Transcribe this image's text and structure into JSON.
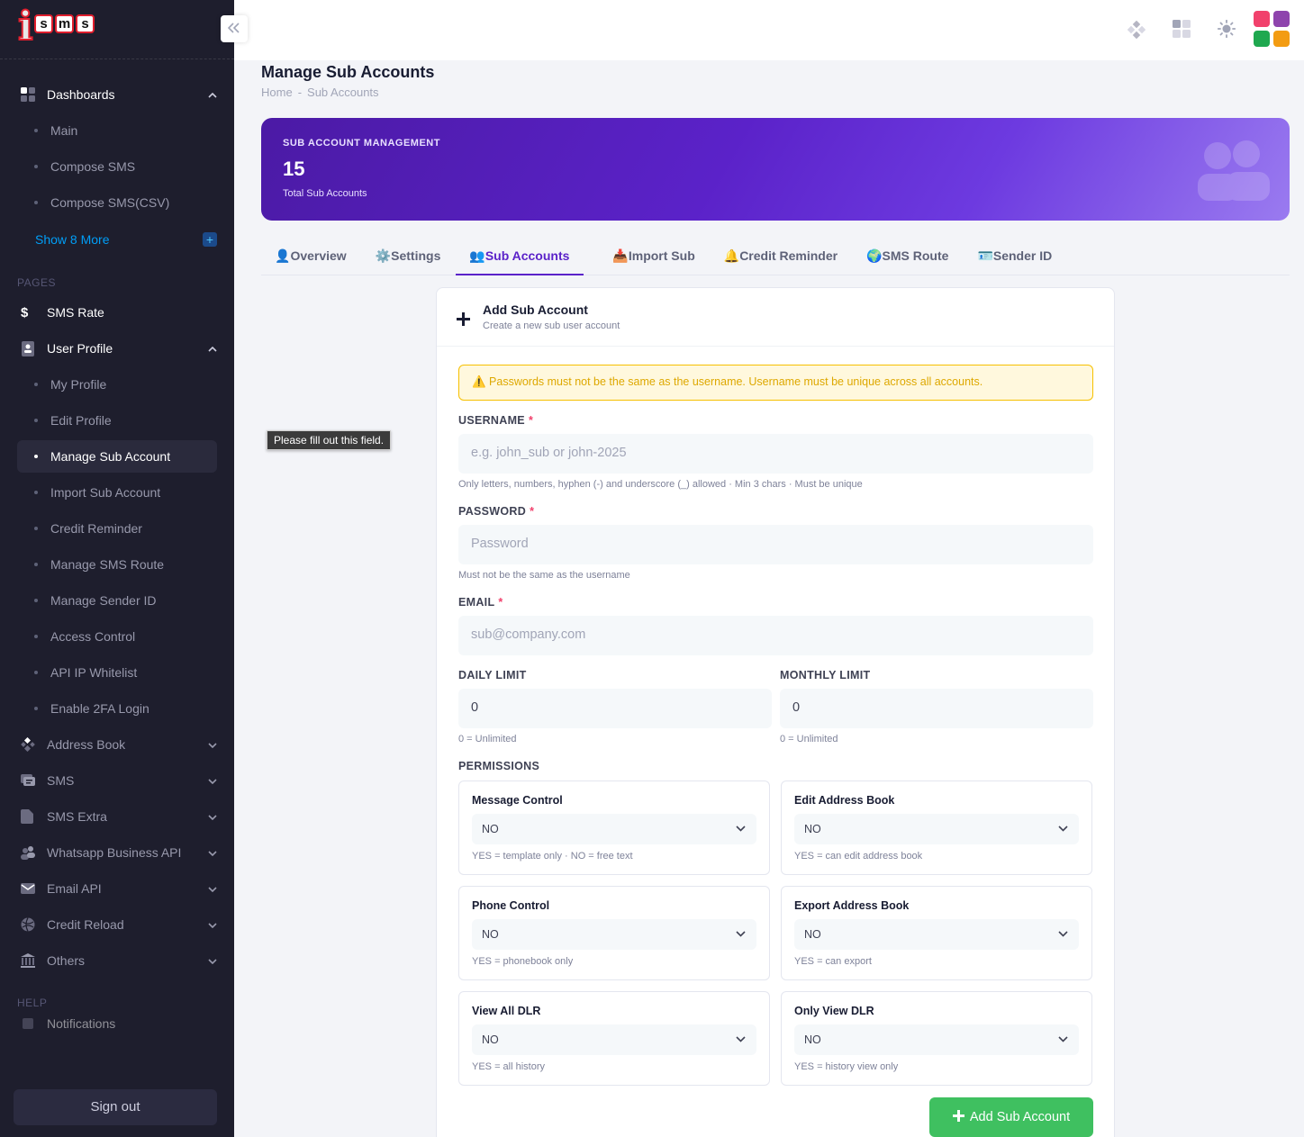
{
  "brand": {
    "logo_letter": "i",
    "logo_boxes": [
      "s",
      "m",
      "s"
    ]
  },
  "sidebar": {
    "collapse_icon": "double-chevron-left-icon",
    "dashboards": {
      "label": "Dashboards",
      "items": [
        "Main",
        "Compose SMS",
        "Compose SMS(CSV)"
      ],
      "show_more": "Show 8 More"
    },
    "pages_label": "PAGES",
    "sms_rate": "SMS Rate",
    "user_profile": {
      "label": "User Profile",
      "items": [
        "My Profile",
        "Edit Profile",
        "Manage Sub Account",
        "Import Sub Account",
        "Credit Reminder",
        "Manage SMS Route",
        "Manage Sender ID",
        "Access Control",
        "API IP Whitelist",
        "Enable 2FA Login"
      ],
      "active_index": 2
    },
    "groups": [
      "Address Book",
      "SMS",
      "SMS Extra",
      "Whatsapp Business API",
      "Email API",
      "Credit Reload",
      "Others"
    ],
    "help_label": "HELP",
    "help_item": "Notifications",
    "signout": "Sign out"
  },
  "topbar": {
    "icons": [
      "diamond-shapes-icon",
      "dashboard-grid-icon",
      "sun-icon",
      "apps-grid-icon"
    ],
    "apps_colors": [
      "#f1416c",
      "#8e44ad",
      "#1fa84f",
      "#f39c12"
    ]
  },
  "page": {
    "title": "Manage Sub Accounts",
    "breadcrumb": [
      "Home",
      "Sub Accounts"
    ],
    "breadcrumb_sep": "-"
  },
  "banner": {
    "label": "SUB ACCOUNT MANAGEMENT",
    "count": "15",
    "sub": "Total Sub Accounts"
  },
  "tabs": [
    {
      "icon": "👤",
      "label": "Overview"
    },
    {
      "icon": "⚙️",
      "label": "Settings"
    },
    {
      "icon": "👥",
      "label": "Sub Accounts"
    },
    {
      "icon": "📥",
      "label": "Import Sub"
    },
    {
      "icon": "🔔",
      "label": "Credit Reminder"
    },
    {
      "icon": "🌍",
      "label": "SMS Route"
    },
    {
      "icon": "🪪",
      "label": "Sender ID"
    }
  ],
  "active_tab": 2,
  "tooltip": "Please fill out this field.",
  "form": {
    "header_title": "Add Sub Account",
    "header_sub": "Create a new sub user account",
    "alert": "⚠️ Passwords must not be the same as the username. Username must be unique across all accounts.",
    "username_label": "USERNAME",
    "username_placeholder": "e.g. john_sub or john-2025",
    "username_hint": "Only letters, numbers, hyphen (-) and underscore (_) allowed · Min 3 chars · Must be unique",
    "password_label": "PASSWORD",
    "password_placeholder": "Password",
    "password_hint": "Must not be the same as the username",
    "email_label": "EMAIL",
    "email_placeholder": "sub@company.com",
    "required_mark": "*",
    "daily_label": "DAILY LIMIT",
    "daily_value": "0",
    "daily_hint": "0 = Unlimited",
    "monthly_label": "MONTHLY LIMIT",
    "monthly_value": "0",
    "monthly_hint": "0 = Unlimited",
    "permissions_label": "PERMISSIONS",
    "permissions": [
      {
        "title": "Message Control",
        "value": "NO",
        "hint": "YES = template only · NO = free text"
      },
      {
        "title": "Edit Address Book",
        "value": "NO",
        "hint": "YES = can edit address book"
      },
      {
        "title": "Phone Control",
        "value": "NO",
        "hint": "YES = phonebook only"
      },
      {
        "title": "Export Address Book",
        "value": "NO",
        "hint": "YES = can export"
      },
      {
        "title": "View All DLR",
        "value": "NO",
        "hint": "YES = all history"
      },
      {
        "title": "Only View DLR",
        "value": "NO",
        "hint": "YES = history view only"
      }
    ],
    "submit_label": "Add Sub Account"
  }
}
